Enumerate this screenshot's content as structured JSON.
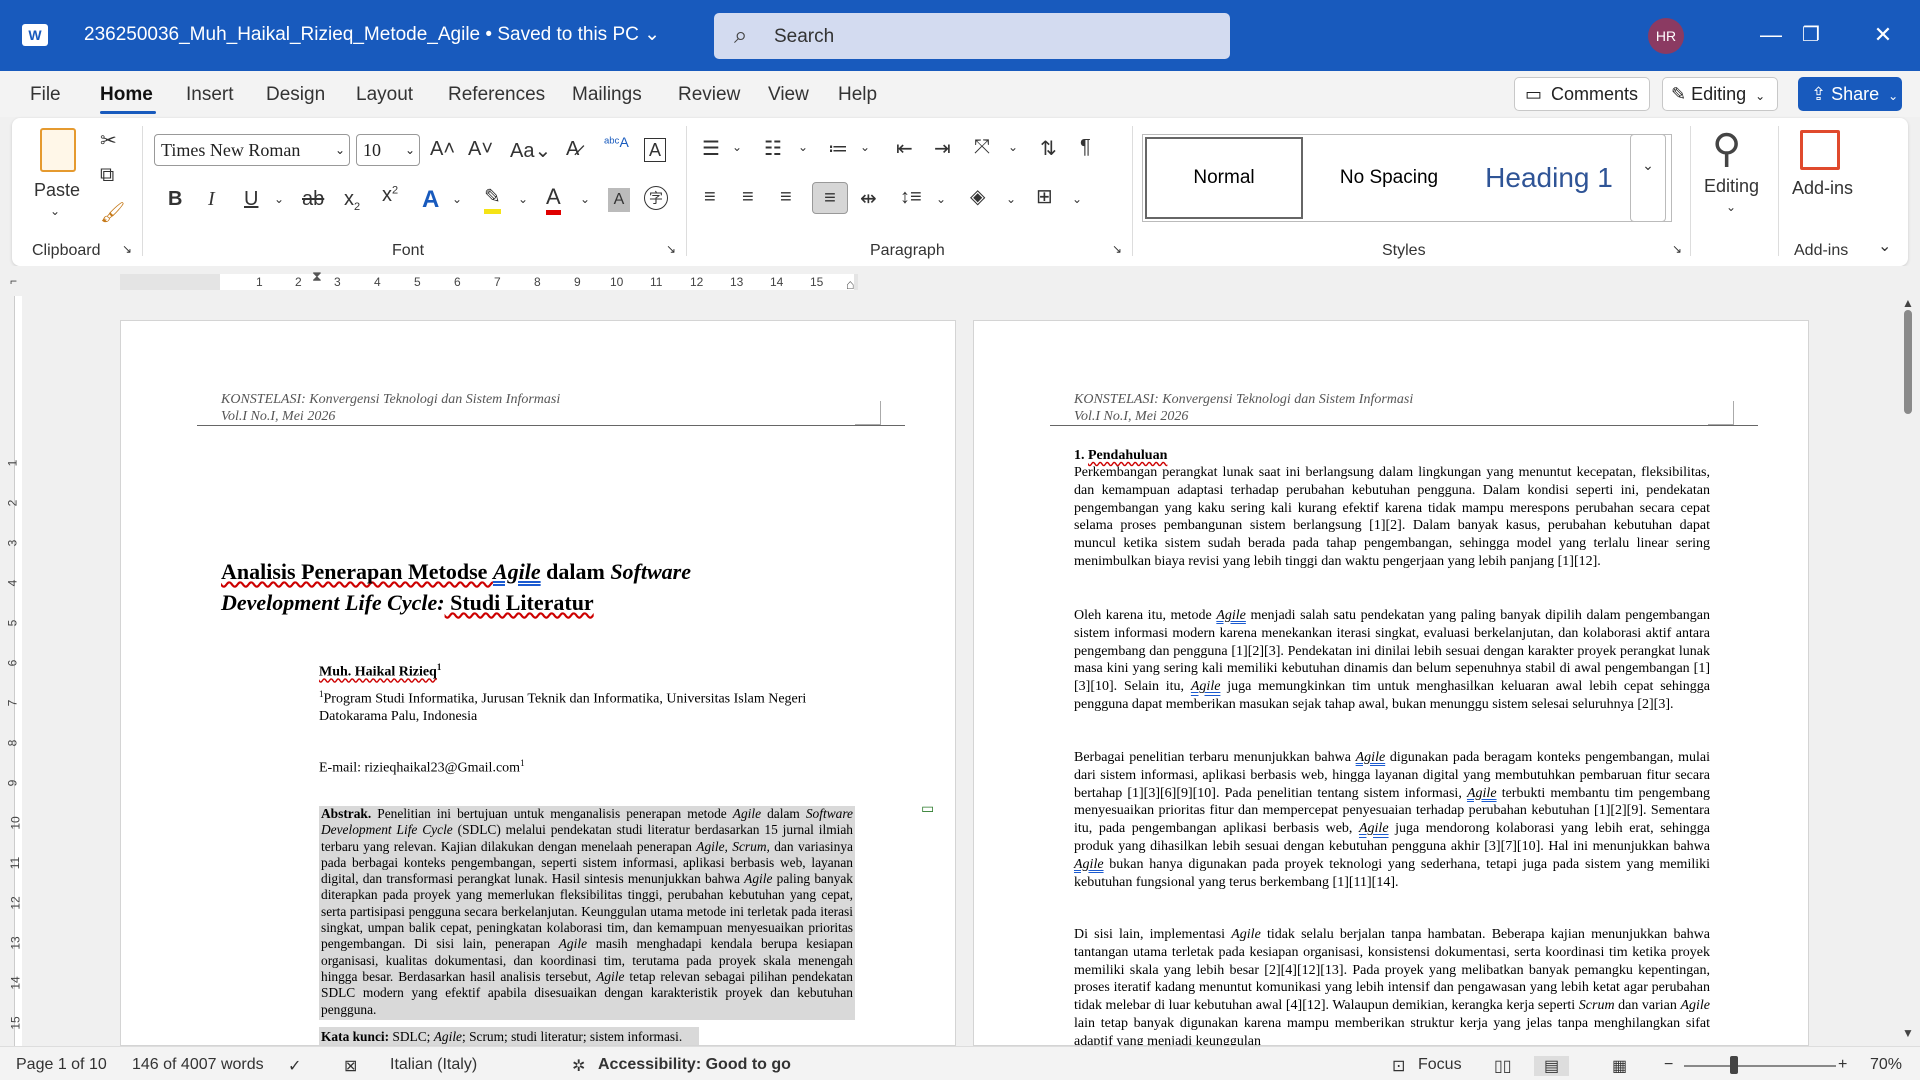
{
  "app": {
    "icon": "W",
    "doc_title": "236250036_Muh_Haikal_Rizieq_Metode_Agile • Saved to this PC ⌄",
    "search_label": "Search",
    "avatar_initials": "HR"
  },
  "menu": {
    "tabs": [
      "File",
      "Home",
      "Insert",
      "Design",
      "Layout",
      "References",
      "Mailings",
      "Review",
      "View",
      "Help"
    ],
    "active": "Home",
    "comments_label": "Comments",
    "editing_label": "Editing",
    "share_label": "Share"
  },
  "ribbon": {
    "paste_label": "Paste",
    "font_name": "Times New Roman",
    "font_size": "10",
    "style_items": [
      "Normal",
      "No Spacing",
      "Heading 1"
    ],
    "editing_label": "Editing",
    "addins_label": "Add-ins",
    "groups": {
      "clipboard": "Clipboard",
      "font": "Font",
      "paragraph": "Paragraph",
      "styles": "Styles",
      "addins": "Add-ins"
    },
    "accent_color": "#185abd"
  },
  "ruler": {
    "numbers": [
      "1",
      "2",
      "3",
      "4",
      "5",
      "6",
      "7",
      "8",
      "9",
      "10",
      "11",
      "12",
      "13",
      "14",
      "15"
    ]
  },
  "vruler": {
    "numbers": [
      "1",
      "2",
      "3",
      "4",
      "5",
      "6",
      "7",
      "8",
      "9",
      "10",
      "11",
      "12",
      "13",
      "14",
      "15"
    ]
  },
  "page1": {
    "header_line1": "KONSTELASI: Konvergensi Teknologi dan Sistem Informasi",
    "header_line2": "Vol.I  No.I, Mei 2026",
    "title_l1_a": "Analisis Penerapan Metodse ",
    "title_l1_b": "Agile",
    "title_l1_c": " dalam ",
    "title_l1_d": "Software",
    "title_l2_a": "Development Life Cycle:",
    "title_l2_b": " Studi Literatur",
    "author": "Muh. Haikal Rizieq",
    "author_sup": "1",
    "affil_sup": "1",
    "affiliation": "Program Studi Informatika, Jurusan Teknik dan Informatika, Universitas Islam Negeri Datokarama Palu, Indonesia",
    "email": "E-mail: rizieqhaikal23@Gmail.com",
    "email_sup": "1",
    "abstract_label": "Abstrak.",
    "abstract_a": " Penelitian ini bertujuan untuk menganalisis penerapan metode ",
    "abstract_b": "Agile",
    "abstract_c": " dalam ",
    "abstract_d": "Software Development Life Cycle",
    "abstract_e": " (SDLC) melalui pendekatan studi literatur berdasarkan 15 jurnal ilmiah terbaru yang relevan. Kajian dilakukan dengan menelaah penerapan ",
    "abstract_f": "Agile, Scrum,",
    "abstract_g": " dan variasinya pada berbagai konteks pengembangan, seperti sistem informasi, aplikasi berbasis web, layanan digital, dan transformasi perangkat lunak. Hasil sintesis menunjukkan bahwa ",
    "abstract_h": "Agile",
    "abstract_i": " paling banyak diterapkan pada proyek yang memerlukan fleksibilitas tinggi, perubahan kebutuhan yang cepat, serta partisipasi pengguna secara berkelanjutan. Keunggulan utama metode ini terletak pada iterasi singkat, umpan balik cepat, peningkatan kolaborasi tim, dan kemampuan menyesuaikan prioritas pengembangan. Di sisi lain, penerapan ",
    "abstract_j": "Agile",
    "abstract_k": " masih menghadapi kendala berupa kesiapan organisasi, kualitas dokumentasi, dan koordinasi tim, terutama pada proyek skala menengah hingga besar. Berdasarkan hasil analisis tersebut, ",
    "abstract_l": "Agile",
    "abstract_m": " tetap relevan sebagai pilihan pendekatan SDLC modern yang efektif apabila disesuaikan dengan karakteristik proyek dan kebutuhan pengguna.",
    "keywords_label": "Kata kunci:",
    "keywords_a": " SDLC;  ",
    "keywords_b": "Agile",
    "keywords_c": "; Scrum; studi literatur; sistem informasi."
  },
  "page2": {
    "header_line1": "KONSTELASI: Konvergensi Teknologi dan Sistem Informasi",
    "header_line2": "Vol.I  No.I, Mei 2026",
    "section_num": "1.",
    "section_title": "Pendahuluan",
    "p1": "Perkembangan perangkat lunak saat ini berlangsung dalam lingkungan yang menuntut kecepatan, fleksibilitas, dan kemampuan adaptasi terhadap perubahan kebutuhan pengguna. Dalam kondisi seperti ini, pendekatan pengembangan yang kaku sering kali kurang efektif karena tidak mampu merespons perubahan secara cepat selama proses pembangunan sistem berlangsung [1][2]. Dalam banyak kasus, perubahan kebutuhan dapat muncul ketika sistem sudah berada pada tahap pengembangan, sehingga model yang terlalu linear sering menimbulkan biaya revisi yang lebih tinggi dan waktu pengerjaan yang lebih panjang [1][12].",
    "p2_a": "Oleh karena itu, metode ",
    "p2_b": "Agile",
    "p2_c": " menjadi salah satu pendekatan yang paling banyak dipilih dalam pengembangan sistem informasi modern karena menekankan iterasi singkat, evaluasi berkelanjutan, dan kolaborasi aktif antara pengembang dan pengguna [1][2][3]. Pendekatan ini dinilai lebih sesuai dengan karakter proyek perangkat lunak masa kini yang sering kali memiliki kebutuhan dinamis dan belum sepenuhnya stabil di awal pengembangan [1][3][10]. Selain itu, ",
    "p2_d": "Agile",
    "p2_e": " juga memungkinkan tim untuk menghasilkan keluaran awal lebih cepat sehingga pengguna dapat memberikan masukan sejak tahap awal, bukan menunggu sistem selesai seluruhnya [2][3].",
    "p3_a": "Berbagai penelitian terbaru menunjukkan bahwa ",
    "p3_b": "Agile",
    "p3_c": " digunakan pada beragam konteks pengembangan, mulai dari sistem informasi, aplikasi berbasis web, hingga layanan digital yang membutuhkan pembaruan fitur secara bertahap [1][3][6][9][10]. Pada penelitian tentang sistem informasi, ",
    "p3_d": "Agile",
    "p3_e": " terbukti membantu tim pengembang menyesuaikan prioritas fitur dan mempercepat penyesuaian terhadap perubahan kebutuhan [1][2][9]. Sementara itu, pada pengembangan aplikasi berbasis web, ",
    "p3_f": "Agile",
    "p3_g": " juga mendorong kolaborasi yang lebih erat, sehingga produk yang dihasilkan lebih sesuai dengan kebutuhan pengguna akhir [3][7][10]. Hal ini menunjukkan bahwa ",
    "p3_h": "Agile",
    "p3_i": " bukan hanya digunakan pada proyek teknologi yang sederhana, tetapi juga pada sistem yang memiliki kebutuhan fungsional yang terus berkembang [1][11][14].",
    "p4_a": "Di sisi lain, implementasi ",
    "p4_b": "Agile",
    "p4_c": " tidak selalu berjalan tanpa hambatan. Beberapa kajian menunjukkan bahwa tantangan utama terletak pada kesiapan organisasi, konsistensi dokumentasi, serta koordinasi tim ketika proyek memiliki skala yang lebih besar [2][4][12][13]. Pada proyek yang melibatkan banyak pemangku kepentingan, proses iteratif kadang menuntut komunikasi yang lebih intensif dan pengawasan yang lebih ketat agar perubahan tidak melebar di luar kebutuhan awal [4][12]. Walaupun demikian, kerangka kerja seperti ",
    "p4_d": "Scrum",
    "p4_e": " dan varian ",
    "p4_f": "Agile",
    "p4_g": " lain tetap banyak digunakan karena mampu memberikan struktur kerja yang jelas tanpa menghilangkan sifat adaptif yang menjadi keunggulan"
  },
  "status": {
    "page": "Page 1 of 10",
    "words": "146 of 4007 words",
    "language": "Italian (Italy)",
    "accessibility": "Accessibility: Good to go",
    "focus": "Focus",
    "zoom": "70%"
  }
}
